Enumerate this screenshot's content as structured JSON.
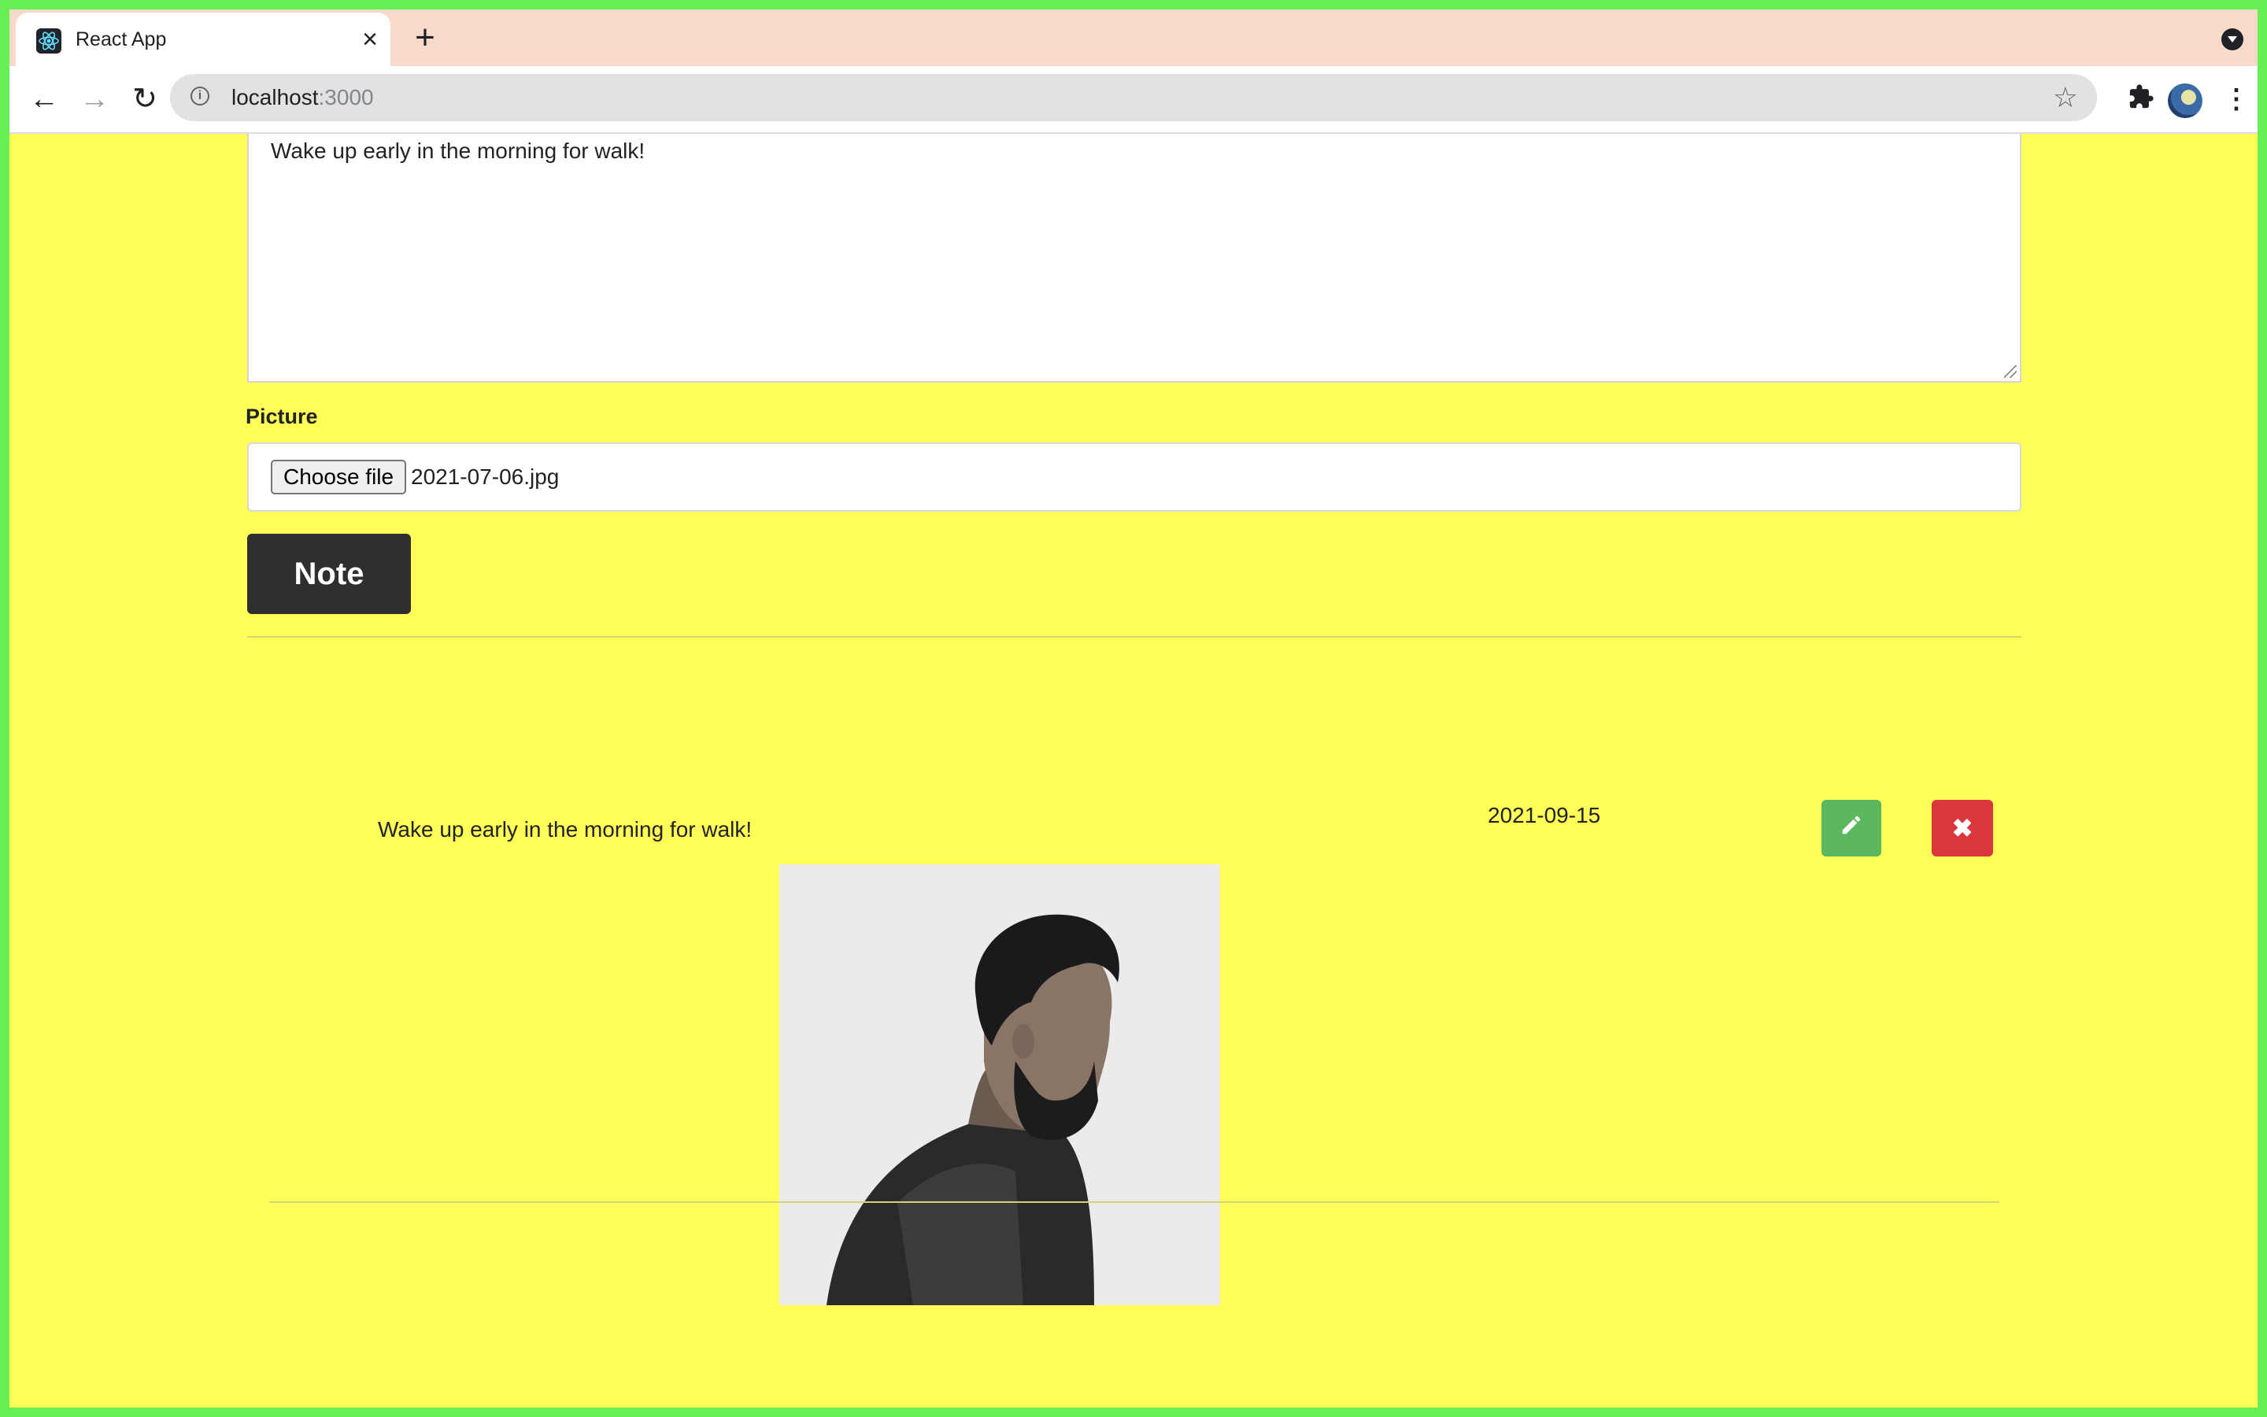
{
  "browser": {
    "tab_title": "React App",
    "tab_close_icon": "close-icon",
    "new_tab_icon": "plus-icon",
    "url_host": "localhost",
    "url_port": ":3000"
  },
  "form": {
    "textarea_value": "Wake up early in the morning for walk!",
    "picture_label": "Picture",
    "choose_file_label": "Choose file",
    "file_name": "2021-07-06.jpg",
    "submit_label": "Note"
  },
  "notes": [
    {
      "text": "Wake up early in the morning for walk!",
      "date": "2021-09-15",
      "edit_icon": "pencil-icon",
      "delete_icon": "close-icon"
    }
  ],
  "colors": {
    "page_background": "#ffff57",
    "frame": "#66f055",
    "tab_strip": "#f8dacb",
    "note_button": "#2f2f30",
    "edit_button": "#5cb85c",
    "delete_button": "#d9363e"
  }
}
